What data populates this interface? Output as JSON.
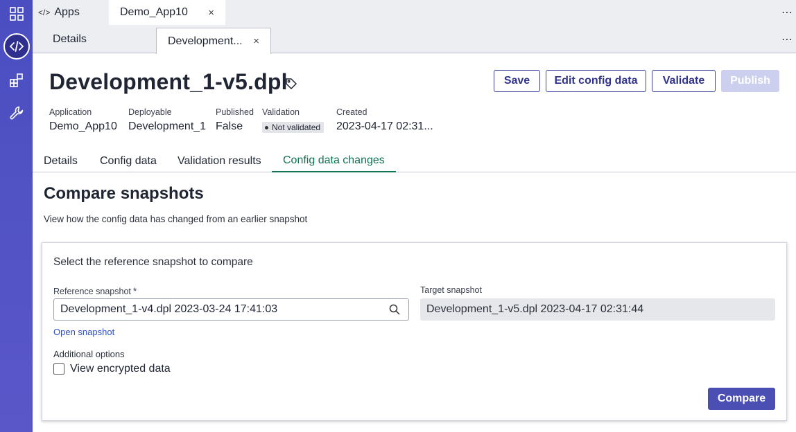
{
  "rail": {
    "icons": [
      "grid-icon",
      "code-icon",
      "components-icon",
      "wrench-icon"
    ]
  },
  "top_tabs": {
    "apps_label": "Apps",
    "app_tab_label": "Demo_App10",
    "close_glyph": "×",
    "more_glyph": "⋯"
  },
  "sub_tabs": {
    "details_label": "Details",
    "dev_label": "Development...",
    "close_glyph": "×",
    "more_glyph": "⋯"
  },
  "header": {
    "title": "Development_1-v5.dpl",
    "buttons": {
      "save": "Save",
      "edit_config": "Edit config data",
      "validate": "Validate",
      "publish": "Publish"
    },
    "meta": {
      "application_label": "Application",
      "application_value": "Demo_App10",
      "deployable_label": "Deployable",
      "deployable_value": "Development_1",
      "published_label": "Published",
      "published_value": "False",
      "validation_label": "Validation",
      "validation_value": "Not validated",
      "created_label": "Created",
      "created_value": "2023-04-17 02:31..."
    }
  },
  "content_tabs": {
    "details": "Details",
    "config_data": "Config data",
    "validation_results": "Validation results",
    "config_data_changes": "Config data changes"
  },
  "compare": {
    "heading": "Compare snapshots",
    "description": "View how the config data has changed from an earlier snapshot",
    "card_title": "Select the reference snapshot to compare",
    "reference_label": "Reference snapshot",
    "required_glyph": "*",
    "reference_value": "Development_1-v4.dpl 2023-03-24 17:41:03",
    "target_label": "Target snapshot",
    "target_value": "Development_1-v5.dpl 2023-04-17 02:31:44",
    "open_snapshot_link": "Open snapshot",
    "additional_options_label": "Additional options",
    "view_encrypted_label": "View encrypted data",
    "compare_button": "Compare"
  },
  "colors": {
    "rail": "#4a4ec0",
    "primary": "#4b4fb3",
    "active_tab": "#12734f",
    "link": "#2f4fc2"
  }
}
